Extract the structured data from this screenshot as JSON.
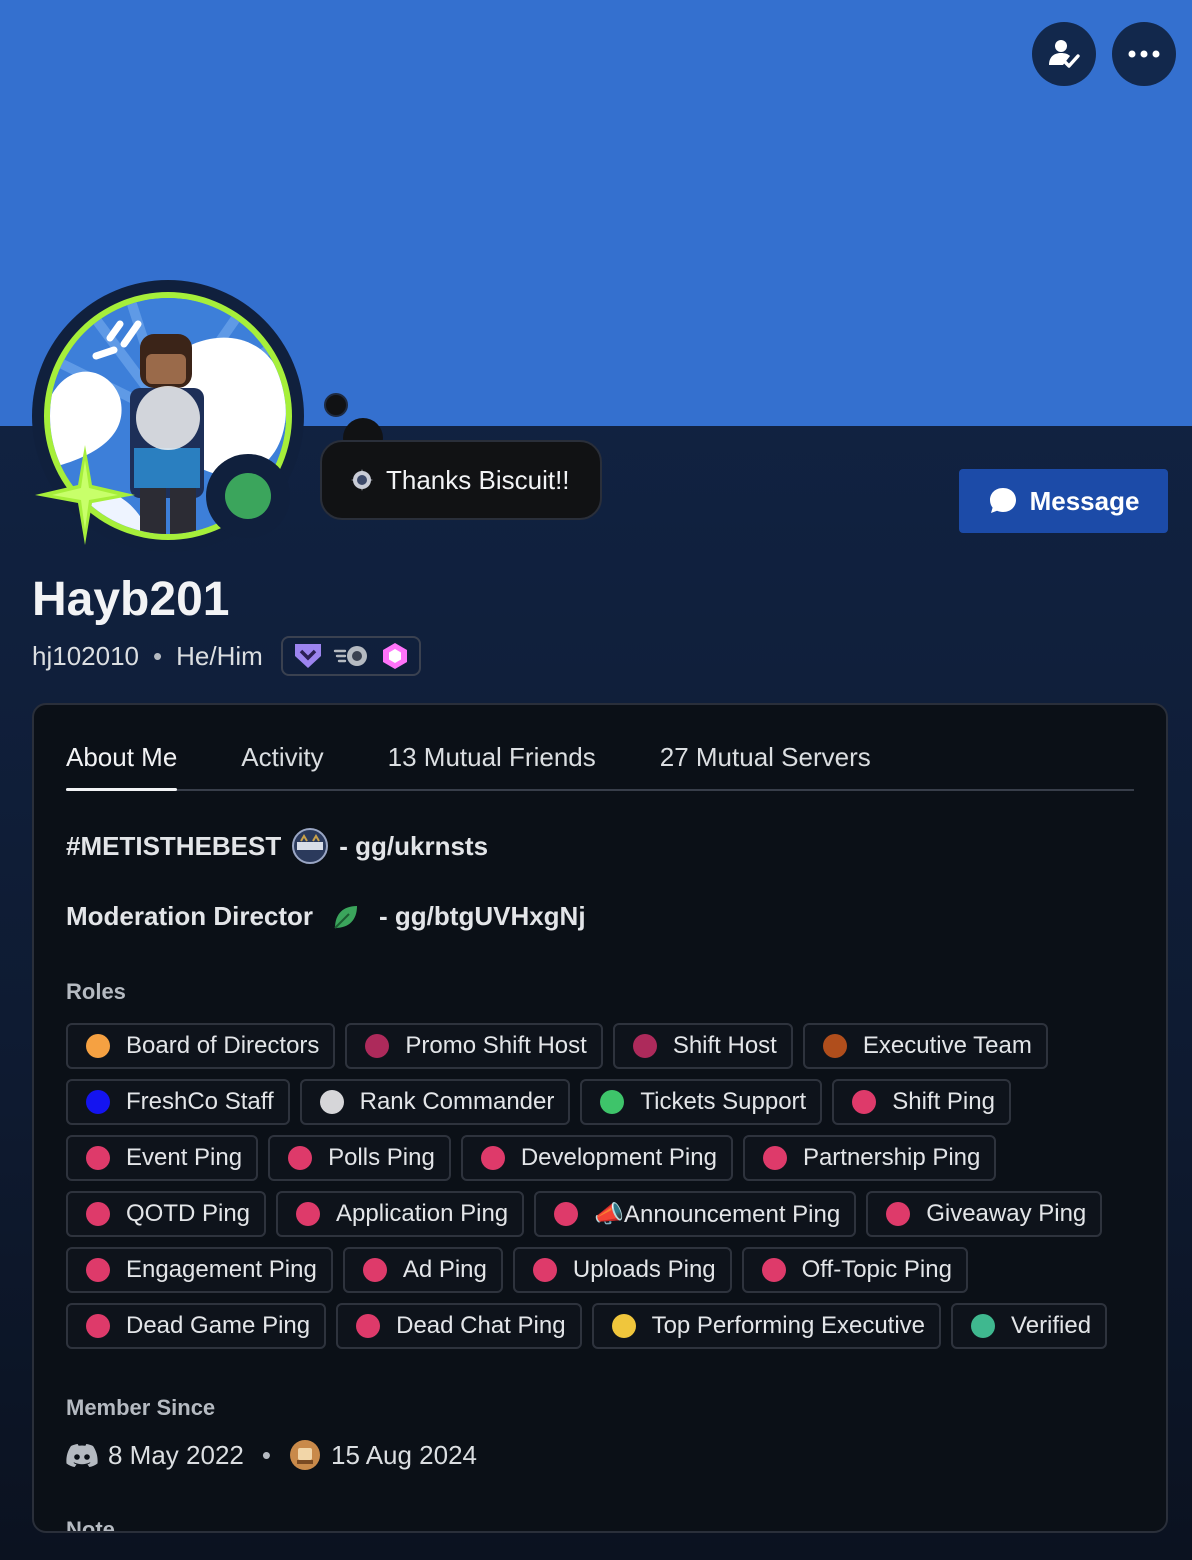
{
  "profile": {
    "display_name": "Hayb201",
    "username": "hj102010",
    "pronouns": "He/Him",
    "custom_status": "Thanks Biscuit!!",
    "message_button": "Message",
    "status": "online",
    "banner_color": "#3470cf"
  },
  "header_actions": [
    {
      "icon": "add-friend-icon"
    },
    {
      "icon": "more-icon"
    }
  ],
  "badges": [
    "hypesquad-icon",
    "speed-icon",
    "nitro-boost-icon"
  ],
  "tabs": [
    "About Me",
    "Activity",
    "13 Mutual Friends",
    "27 Mutual Servers"
  ],
  "bio": {
    "line1_left": "#METISTHEBEST",
    "line1_right": "- gg/ukrnsts",
    "line2_left": "Moderation Director",
    "line2_right": "- gg/btgUVHxgNj"
  },
  "roles_heading": "Roles",
  "roles": [
    [
      {
        "name": "Board of Directors",
        "color": "#f5a142"
      },
      {
        "name": "Promo Shift Host",
        "color": "#ad2a5b"
      },
      {
        "name": "Shift Host",
        "color": "#ad2a5b"
      },
      {
        "name": "Executive Team",
        "color": "#b04e1c"
      }
    ],
    [
      {
        "name": "FreshCo Staff",
        "color": "#1414f0"
      },
      {
        "name": "Rank Commander",
        "color": "#d6d6d9"
      },
      {
        "name": "Tickets Support",
        "color": "#3ec46a"
      },
      {
        "name": "Shift Ping",
        "color": "#de3a6a"
      }
    ],
    [
      {
        "name": "Event Ping",
        "color": "#de3a6a"
      },
      {
        "name": "Polls Ping",
        "color": "#de3a6a"
      },
      {
        "name": "Development Ping",
        "color": "#de3a6a"
      },
      {
        "name": "Partnership Ping",
        "color": "#de3a6a"
      }
    ],
    [
      {
        "name": "QOTD Ping",
        "color": "#de3a6a"
      },
      {
        "name": "Application Ping",
        "color": "#de3a6a"
      },
      {
        "name": "📣Announcement Ping",
        "color": "#de3a6a"
      },
      {
        "name": "Giveaway Ping",
        "color": "#de3a6a"
      }
    ],
    [
      {
        "name": "Engagement Ping",
        "color": "#de3a6a"
      },
      {
        "name": "Ad Ping",
        "color": "#de3a6a"
      },
      {
        "name": "Uploads Ping",
        "color": "#de3a6a"
      },
      {
        "name": "Off-Topic Ping",
        "color": "#de3a6a"
      }
    ],
    [
      {
        "name": "Dead Game Ping",
        "color": "#de3a6a"
      },
      {
        "name": "Dead Chat Ping",
        "color": "#de3a6a"
      },
      {
        "name": "Top Performing Executive",
        "color": "#f0c63c"
      },
      {
        "name": "Verified",
        "color": "#3fb88f"
      }
    ]
  ],
  "member_since_heading": "Member Since",
  "member_since": {
    "discord": "8 May 2022",
    "server": "15 Aug 2024"
  },
  "note_heading": "Note"
}
